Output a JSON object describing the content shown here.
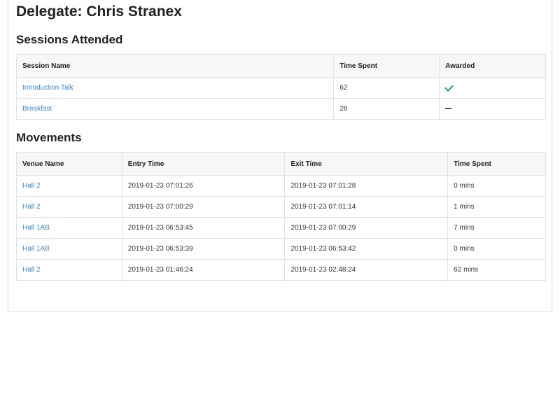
{
  "page": {
    "title": "Delegate: Chris Stranex"
  },
  "sessions": {
    "heading": "Sessions Attended",
    "columns": [
      "Session Name",
      "Time Spent",
      "Awarded"
    ],
    "rows": [
      {
        "name": "Introduction Talk",
        "time_spent": "62",
        "awarded": "check-icon"
      },
      {
        "name": "Breakfast",
        "time_spent": "26",
        "awarded": "dash-icon"
      }
    ]
  },
  "movements": {
    "heading": "Movements",
    "columns": [
      "Venue Name",
      "Entry Time",
      "Exit Time",
      "Time Spent"
    ],
    "rows": [
      {
        "venue": "Hall 2",
        "entry": "2019-01-23 07:01:26",
        "exit": "2019-01-23 07:01:28",
        "time_spent": "0 mins"
      },
      {
        "venue": "Hall 2",
        "entry": "2019-01-23 07:00:29",
        "exit": "2019-01-23 07:01:14",
        "time_spent": "1 mins"
      },
      {
        "venue": "Hall 1AB",
        "entry": "2019-01-23 06:53:45",
        "exit": "2019-01-23 07:00:29",
        "time_spent": "7 mins"
      },
      {
        "venue": "Hall 1AB",
        "entry": "2019-01-23 06:53:39",
        "exit": "2019-01-23 06:53:42",
        "time_spent": "0 mins"
      },
      {
        "venue": "Hall 2",
        "entry": "2019-01-23 01:46:24",
        "exit": "2019-01-23 02:48:24",
        "time_spent": "62 mins"
      }
    ]
  },
  "colors": {
    "link": "#3a87c8",
    "check": "#28a745"
  }
}
